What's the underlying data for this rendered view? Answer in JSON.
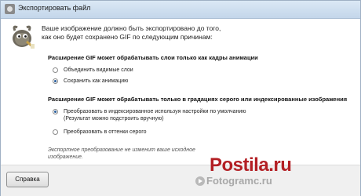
{
  "window": {
    "title": "Экспортировать файл"
  },
  "intro": {
    "text": "Ваше изображение должно быть экспортировано до того, как оно будет сохранено GIF по следующим причинам:"
  },
  "section1": {
    "heading": "Расширение GIF может обрабатывать слои только как кадры анимации",
    "options": [
      {
        "label": "Объединить видимые слои",
        "checked": false
      },
      {
        "label": "Сохранить как анимацию",
        "checked": true
      }
    ]
  },
  "section2": {
    "heading": "Расширение GIF может обрабатывать только в градациях серого или индексированные изображения",
    "options": [
      {
        "label": "Преобразовать в индексированное используя настройки по умолчанию",
        "label2": "(Результат можно подстроить вручную)",
        "checked": true
      },
      {
        "label": "Преобразовать в оттенки серого",
        "checked": false
      }
    ]
  },
  "note": {
    "text": "Экспортное преобразование не изменит ваше исходное изображение."
  },
  "buttons": {
    "help_label": "Справка"
  },
  "watermark": {
    "brand": "Postila.ru",
    "domain": "Fotogramc.ru"
  },
  "colors": {
    "accent": "#2a5f9e",
    "watermark_red": "#b31f24"
  }
}
